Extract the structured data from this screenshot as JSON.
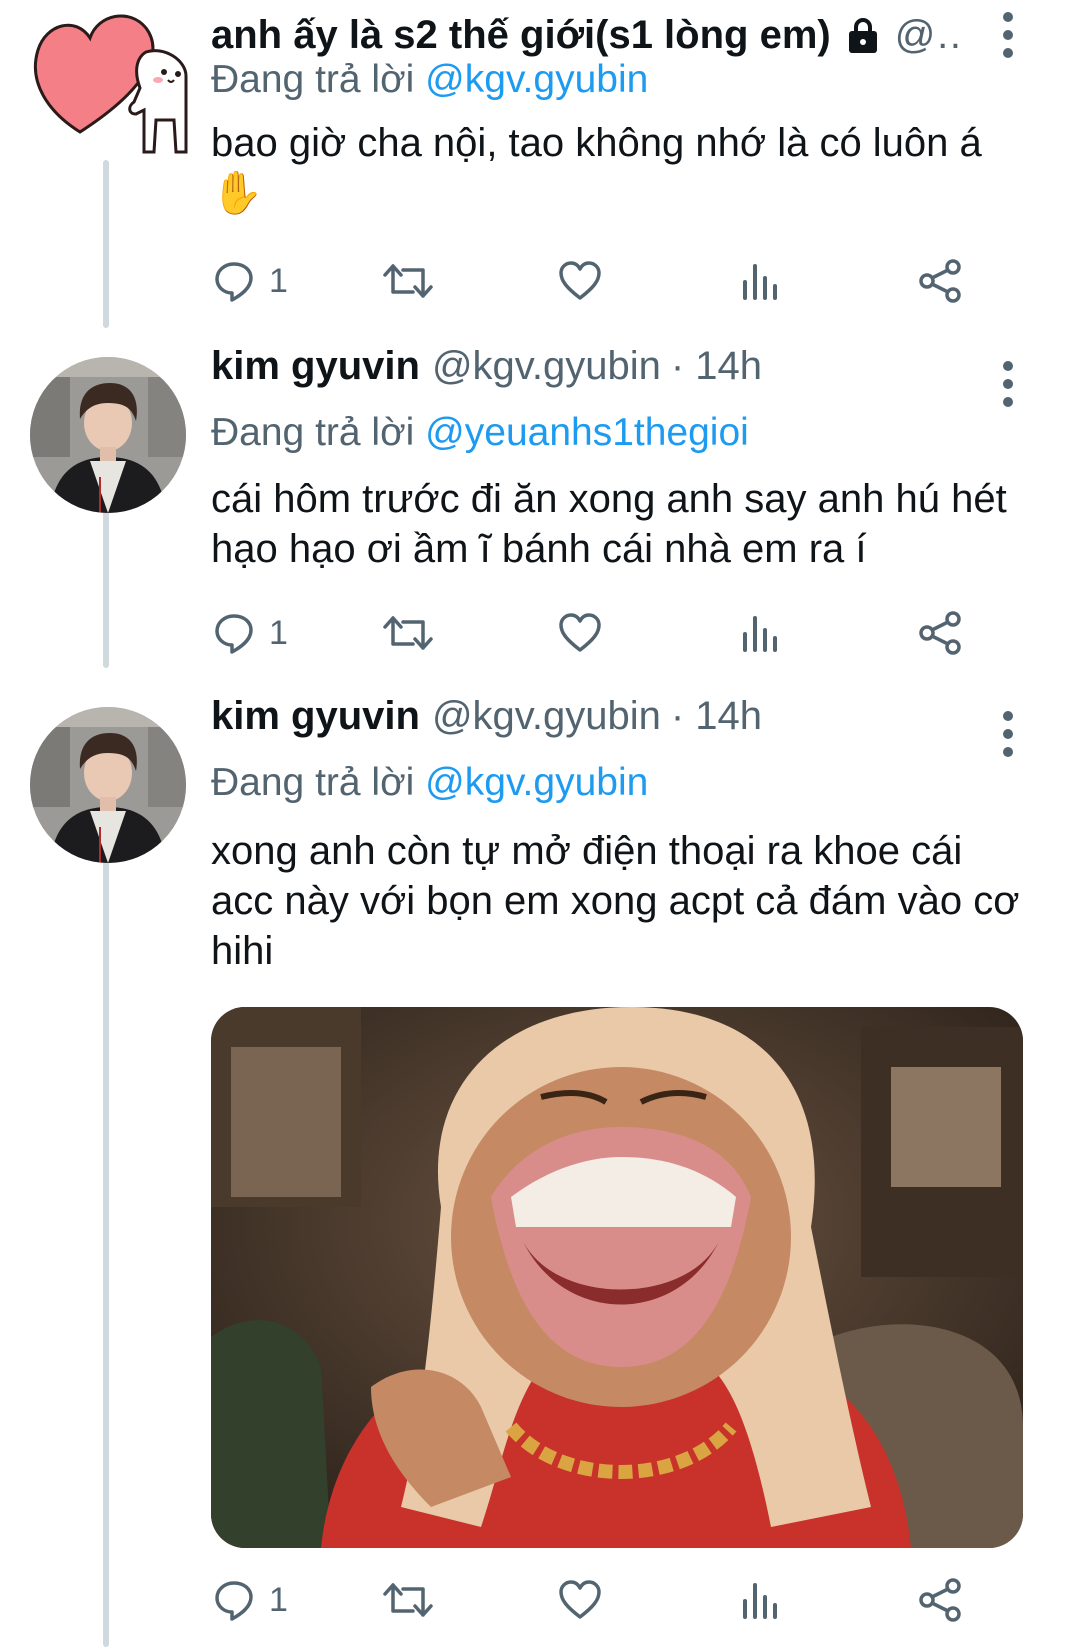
{
  "tweets": [
    {
      "author_name": "anh ấy là s2 thế giới(s1 lòng em)",
      "author_handle": "@y...",
      "timestamp": "",
      "replying_prefix": "Đang trả lời",
      "replying_to": "@kgv.gyubin",
      "text": "bao giờ cha nội, tao không nhớ là có luôn á",
      "emoji": "✋",
      "locked": true,
      "reply_count": "1",
      "avatar": "heart-cartoon-avatar"
    },
    {
      "author_name": "kim gyuvin",
      "author_handle": "@kgv.gyubin",
      "timestamp": "· 14h",
      "replying_prefix": "Đang trả lời",
      "replying_to": "@yeuanhs1thegioi",
      "text": "cái hôm trước đi ăn xong anh say anh hú hét hạo hạo ơi ầm ĩ bánh cái nhà em ra í",
      "reply_count": "1",
      "avatar": "profile-photo-avatar"
    },
    {
      "author_name": "kim gyuvin",
      "author_handle": "@kgv.gyubin",
      "timestamp": "· 14h",
      "replying_prefix": "Đang trả lời",
      "replying_to": "@kgv.gyubin",
      "text": "xong anh còn tự mở điện thoại ra khoe cái acc này với bọn em xong acpt cả đám vào cơ hihi",
      "reply_count": "1",
      "avatar": "profile-photo-avatar",
      "media": "laughing-meme-image"
    }
  ],
  "colors": {
    "accent": "#1d9bf0",
    "secondary_text": "#536471",
    "thread_line": "#cfd9de"
  }
}
